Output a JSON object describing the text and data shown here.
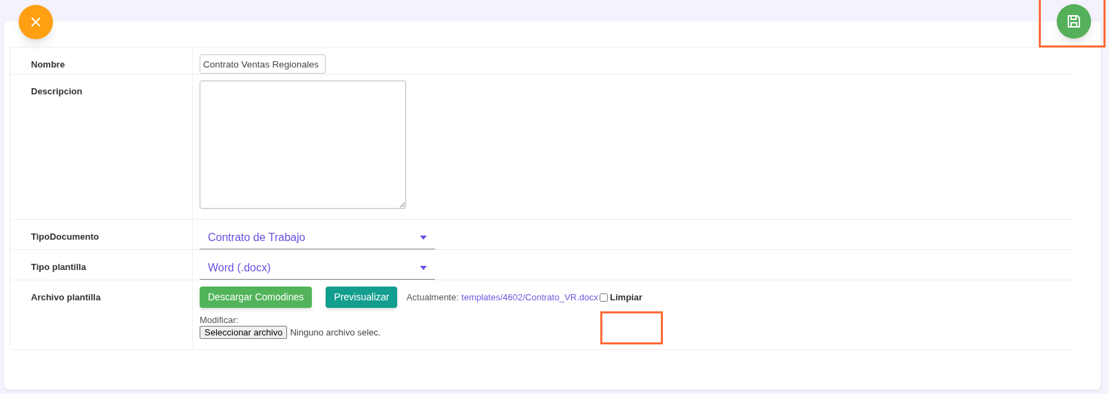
{
  "form": {
    "rows": [
      {
        "kind": "text",
        "label": "Nombre",
        "value": "Contrato Ventas Regionales"
      },
      {
        "kind": "textarea",
        "label": "Descripcion"
      },
      {
        "kind": "select",
        "label": "TipoDocumento",
        "value": "Contrato de Trabajo"
      },
      {
        "kind": "select",
        "label": "Tipo plantilla",
        "value": "Word (.docx)"
      },
      {
        "kind": "file",
        "label": "Archivo plantilla",
        "buttons": [
          "Descargar Comodines",
          "Previsualizar"
        ],
        "current_label": "Actualmente:",
        "current_link": "templates/4602/Contrato_VR.docx",
        "clear": {
          "label": "Limpiar",
          "checked": false
        },
        "modify_label": "Modificar:",
        "file_button": "Seleccionar archivo",
        "file_status": "Ninguno archivo selec."
      }
    ]
  }
}
